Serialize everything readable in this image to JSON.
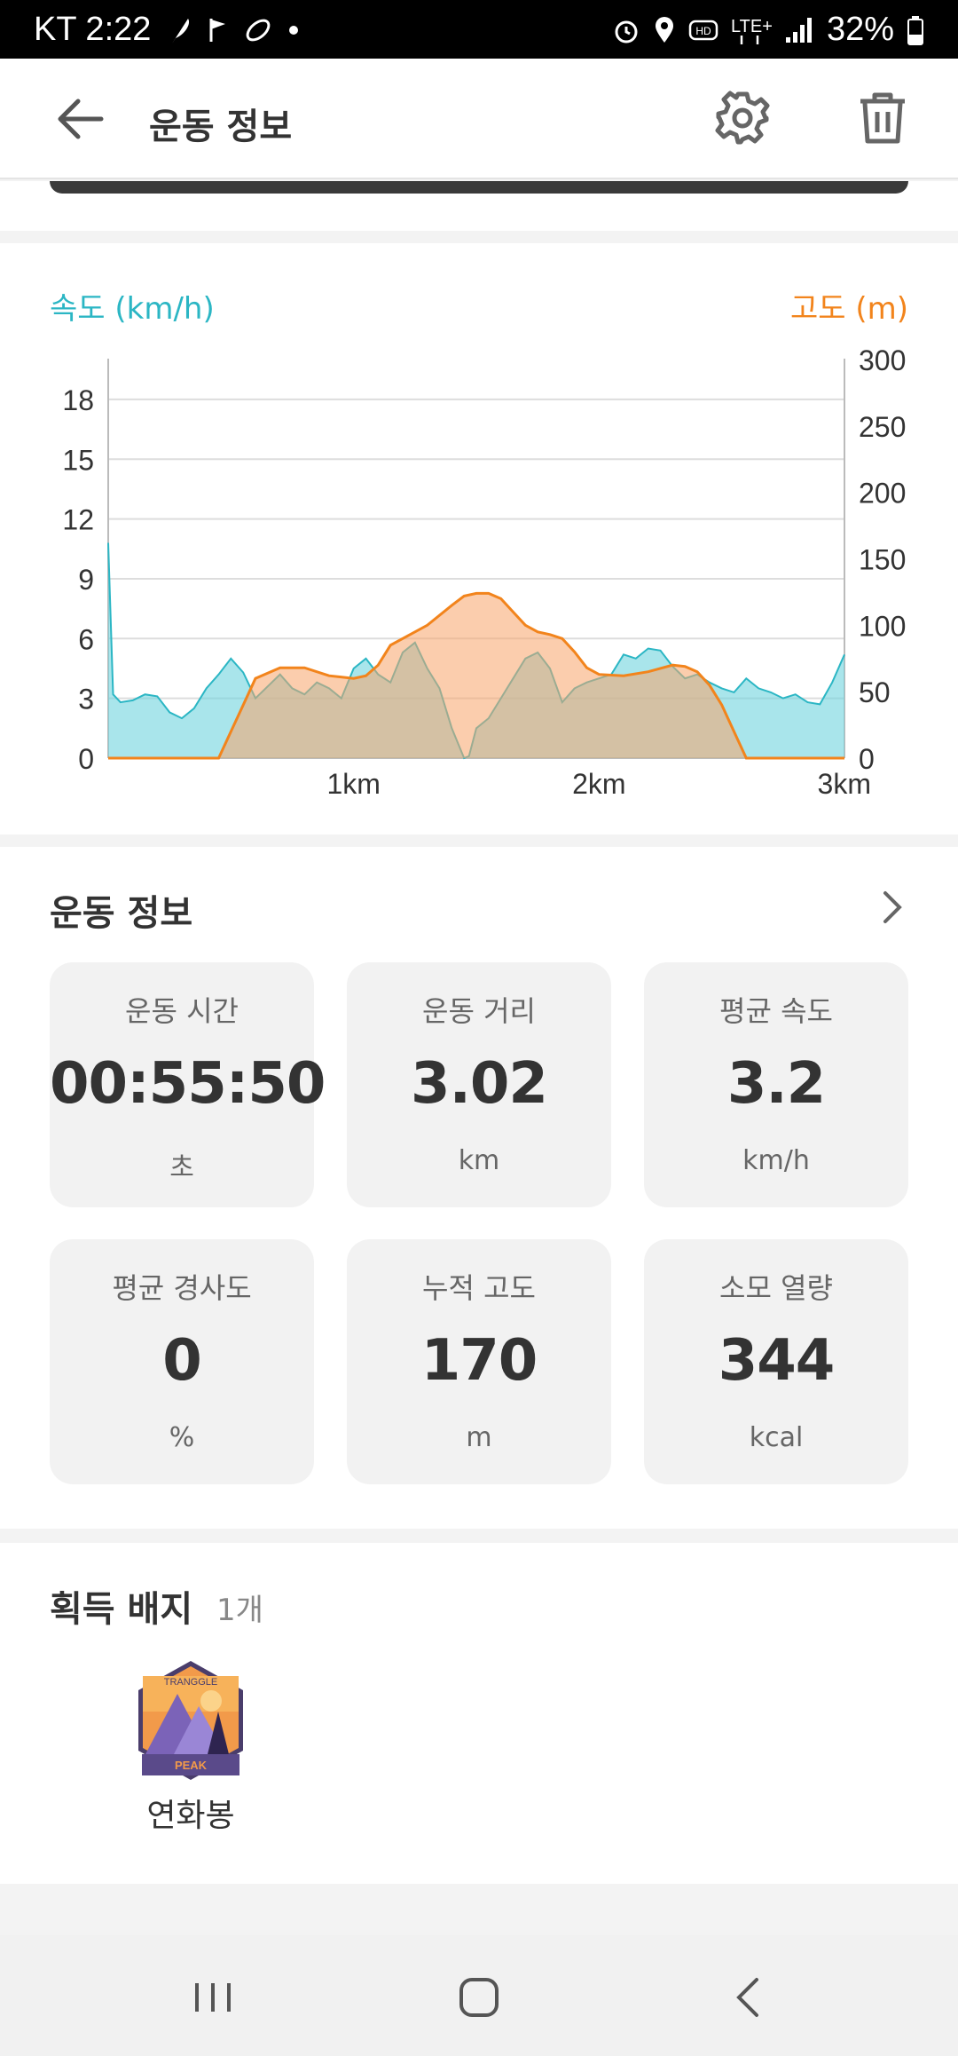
{
  "status_bar": {
    "carrier_time": "KT 2:22",
    "battery": "32%",
    "icons": [
      "feather-icon",
      "flag-icon",
      "shoe-icon",
      "dot-icon",
      "alarm-icon",
      "location-icon",
      "hd-icon",
      "lte-icon",
      "signal-icon",
      "battery-icon"
    ]
  },
  "appbar": {
    "title": "운동 정보",
    "icons": [
      "back-arrow-icon",
      "gear-icon",
      "trash-icon"
    ]
  },
  "chart": {
    "left_label": "속도 (km/h)",
    "right_label": "고도 (m)",
    "left_color": "#2bb6c4",
    "right_color": "#f2841c",
    "left_ticks": [
      "0",
      "3",
      "6",
      "9",
      "12",
      "15",
      "18"
    ],
    "right_ticks": [
      "0",
      "50",
      "100",
      "150",
      "200",
      "250",
      "300"
    ],
    "x_ticks": [
      "1km",
      "2km",
      "3km"
    ]
  },
  "chart_data": {
    "type": "area",
    "xlabel": "",
    "xlim": [
      0,
      3
    ],
    "ylim_left": [
      0,
      20
    ],
    "ylim_right": [
      0,
      300
    ],
    "series": [
      {
        "name": "속도 (km/h)",
        "axis": "left",
        "x": [
          0,
          0.02,
          0.05,
          0.1,
          0.15,
          0.2,
          0.25,
          0.3,
          0.35,
          0.4,
          0.45,
          0.5,
          0.55,
          0.6,
          0.65,
          0.7,
          0.75,
          0.8,
          0.85,
          0.9,
          0.95,
          1.0,
          1.05,
          1.1,
          1.15,
          1.2,
          1.25,
          1.3,
          1.35,
          1.4,
          1.45,
          1.47,
          1.5,
          1.55,
          1.6,
          1.65,
          1.7,
          1.75,
          1.8,
          1.85,
          1.9,
          1.95,
          2.0,
          2.05,
          2.1,
          2.15,
          2.2,
          2.25,
          2.3,
          2.35,
          2.4,
          2.45,
          2.5,
          2.55,
          2.6,
          2.65,
          2.7,
          2.75,
          2.8,
          2.85,
          2.9,
          2.95,
          3.0
        ],
        "values": [
          10.8,
          3.2,
          2.8,
          2.9,
          3.2,
          3.1,
          2.3,
          2.0,
          2.5,
          3.5,
          4.2,
          5.0,
          4.3,
          3.0,
          3.6,
          4.2,
          3.5,
          3.2,
          3.8,
          3.5,
          3.0,
          4.5,
          5.0,
          4.2,
          3.8,
          5.3,
          5.8,
          4.5,
          3.5,
          1.5,
          0.0,
          0.1,
          1.5,
          2.0,
          3.0,
          4.0,
          5.0,
          5.3,
          4.5,
          2.8,
          3.5,
          3.8,
          4.0,
          4.2,
          5.2,
          5.0,
          5.5,
          5.4,
          4.6,
          4.0,
          4.2,
          3.8,
          3.5,
          3.3,
          4.0,
          3.5,
          3.3,
          3.0,
          3.2,
          2.8,
          2.7,
          3.8,
          5.2
        ]
      },
      {
        "name": "고도 (m)",
        "axis": "right",
        "x": [
          0,
          0.45,
          0.5,
          0.55,
          0.6,
          0.7,
          0.8,
          0.9,
          1.0,
          1.05,
          1.1,
          1.15,
          1.2,
          1.3,
          1.4,
          1.45,
          1.5,
          1.55,
          1.6,
          1.65,
          1.7,
          1.75,
          1.8,
          1.85,
          1.9,
          1.95,
          2.0,
          2.1,
          2.2,
          2.3,
          2.35,
          2.4,
          2.45,
          2.5,
          2.55,
          2.6,
          3.0
        ],
        "values": [
          0,
          0,
          20,
          40,
          60,
          68,
          68,
          62,
          60,
          62,
          70,
          85,
          90,
          100,
          115,
          122,
          124,
          124,
          120,
          110,
          100,
          95,
          93,
          90,
          80,
          68,
          63,
          62,
          65,
          70,
          69,
          65,
          55,
          40,
          20,
          0,
          0
        ]
      }
    ]
  },
  "workout": {
    "title": "운동 정보",
    "tiles": [
      {
        "label": "운동 시간",
        "value": "00:55:50",
        "unit": "초"
      },
      {
        "label": "운동 거리",
        "value": "3.02",
        "unit": "km"
      },
      {
        "label": "평균 속도",
        "value": "3.2",
        "unit": "km/h"
      },
      {
        "label": "평균 경사도",
        "value": "0",
        "unit": "%"
      },
      {
        "label": "누적 고도",
        "value": "170",
        "unit": "m"
      },
      {
        "label": "소모 열량",
        "value": "344",
        "unit": "kcal"
      }
    ]
  },
  "badges": {
    "title": "획득 배지",
    "count": "1개",
    "items": [
      {
        "name": "연화봉",
        "badge_top_text": "TRANGGLE",
        "badge_bottom_text": "PEAK"
      }
    ]
  },
  "navbar": {
    "icons": [
      "recent-apps-icon",
      "home-icon",
      "back-icon"
    ]
  }
}
